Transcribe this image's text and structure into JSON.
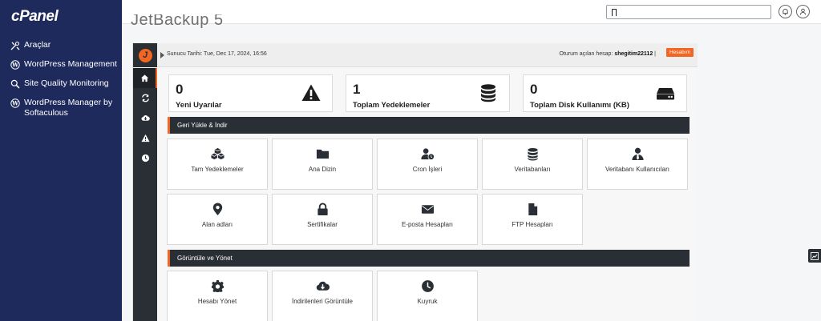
{
  "sidebar": {
    "logo": "cPanel",
    "items": [
      {
        "label": "Araçlar",
        "icon": "tools-icon"
      },
      {
        "label": "WordPress Management",
        "icon": "wordpress-icon"
      },
      {
        "label": "Site Quality Monitoring",
        "icon": "magnifier-icon"
      },
      {
        "label": "WordPress Manager by Softaculous",
        "icon": "wordpress-icon"
      }
    ]
  },
  "topbar": {
    "search_value": "∏",
    "icons": [
      "bell-icon",
      "user-icon"
    ]
  },
  "page": {
    "title": "JetBackup 5"
  },
  "jetbackup": {
    "server_date": "Sunucu Tarihi: Tue, Dec 17, 2024, 16:56",
    "logged_in_label": "Oturum açılan hesap:",
    "username": "shegitim22112",
    "separator": "|",
    "account_button": "Hesabım",
    "side_icons": [
      "home-icon",
      "refresh-icon",
      "cloud-download-icon",
      "warning-icon",
      "clock-icon"
    ],
    "stats": [
      {
        "value": "0",
        "label": "Yeni Uyarılar",
        "icon": "warning-icon"
      },
      {
        "value": "1",
        "label": "Toplam Yedeklemeler",
        "icon": "database-icon"
      },
      {
        "value": "0",
        "label": "Toplam Disk Kullanımı (KB)",
        "icon": "hdd-icon"
      }
    ],
    "sections": [
      {
        "title": "Geri Yükle & İndir",
        "tiles": [
          {
            "label": "Tam Yedeklemeler",
            "icon": "cubes-icon"
          },
          {
            "label": "Ana Dizin",
            "icon": "folder-icon"
          },
          {
            "label": "Cron İşleri",
            "icon": "user-clock-icon"
          },
          {
            "label": "Veritabanları",
            "icon": "database-icon"
          },
          {
            "label": "Veritabanı Kullanıcıları",
            "icon": "user-tie-icon"
          },
          {
            "label": "Alan adları",
            "icon": "map-marker-icon"
          },
          {
            "label": "Sertifikalar",
            "icon": "lock-icon"
          },
          {
            "label": "E-posta Hesapları",
            "icon": "envelope-icon"
          },
          {
            "label": "FTP Hesapları",
            "icon": "file-icon"
          }
        ]
      },
      {
        "title": "Görüntüle ve Yönet",
        "tiles": [
          {
            "label": "Hesabı Yönet",
            "icon": "gear-icon"
          },
          {
            "label": "İndirilenleri Görüntüle",
            "icon": "cloud-download-icon"
          },
          {
            "label": "Kuyruk",
            "icon": "clock-icon"
          }
        ]
      }
    ]
  },
  "colors": {
    "sidebar_bg": "#1f2a5c",
    "jb_dark": "#2a2f36",
    "accent": "#f26522"
  }
}
